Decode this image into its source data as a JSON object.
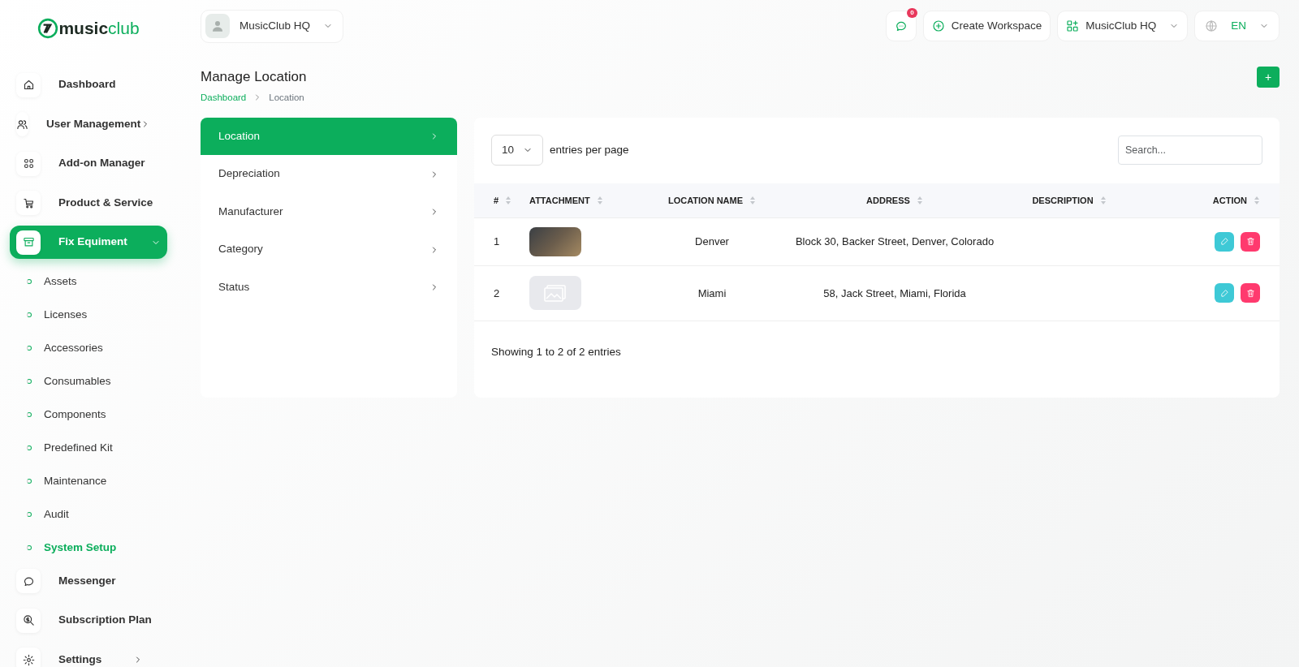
{
  "logo": {
    "word_1": "music",
    "word_2": "club"
  },
  "workspace_switcher": {
    "label": "MusicClub HQ"
  },
  "topbar": {
    "notification_count": "0",
    "create_label": "Create Workspace",
    "workspace_label": "MusicClub HQ",
    "language": "EN"
  },
  "sidebar": {
    "items": [
      {
        "label": "Dashboard",
        "has_submenu": false,
        "selected": false
      },
      {
        "label": "User Management",
        "has_submenu": true,
        "selected": false
      },
      {
        "label": "Add-on Manager",
        "has_submenu": false,
        "selected": false
      },
      {
        "label": "Product & Service",
        "has_submenu": false,
        "selected": false
      },
      {
        "label": "Fix Equiment",
        "has_submenu": true,
        "selected": true,
        "expanded": true,
        "children": [
          {
            "label": "Assets",
            "selected": false
          },
          {
            "label": "Licenses",
            "selected": false
          },
          {
            "label": "Accessories",
            "selected": false
          },
          {
            "label": "Consumables",
            "selected": false
          },
          {
            "label": "Components",
            "selected": false
          },
          {
            "label": "Predefined Kit",
            "selected": false
          },
          {
            "label": "Maintenance",
            "selected": false
          },
          {
            "label": "Audit",
            "selected": false
          },
          {
            "label": "System Setup",
            "selected": true
          }
        ]
      },
      {
        "label": "Messenger",
        "has_submenu": false,
        "selected": false
      },
      {
        "label": "Subscription Plan",
        "has_submenu": false,
        "selected": false
      },
      {
        "label": "Settings",
        "has_submenu": true,
        "selected": false
      }
    ]
  },
  "page": {
    "title": "Manage Location",
    "breadcrumb": [
      {
        "label": "Dashboard",
        "kind": "link"
      },
      {
        "label": "Location",
        "kind": "current"
      }
    ],
    "add_button": "+"
  },
  "setup_menu": [
    {
      "label": "Location",
      "selected": true
    },
    {
      "label": "Depreciation",
      "selected": false
    },
    {
      "label": "Manufacturer",
      "selected": false
    },
    {
      "label": "Category",
      "selected": false
    },
    {
      "label": "Status",
      "selected": false
    }
  ],
  "table": {
    "page_size": "10",
    "page_size_label": "entries per page",
    "search_placeholder": "Search...",
    "columns": [
      "#",
      "ATTACHMENT",
      "LOCATION NAME",
      "ADDRESS",
      "DESCRIPTION",
      "ACTION"
    ],
    "rows": [
      {
        "number": "1",
        "kind": "photo",
        "location_name": "Denver",
        "address": "Block 30, Backer Street, Denver, Colorado"
      },
      {
        "number": "2",
        "kind": "placeholder",
        "location_name": "Miami",
        "address": "58, Jack Street, Miami, Florida"
      }
    ],
    "footer": "Showing 1 to 2 of 2 entries"
  }
}
